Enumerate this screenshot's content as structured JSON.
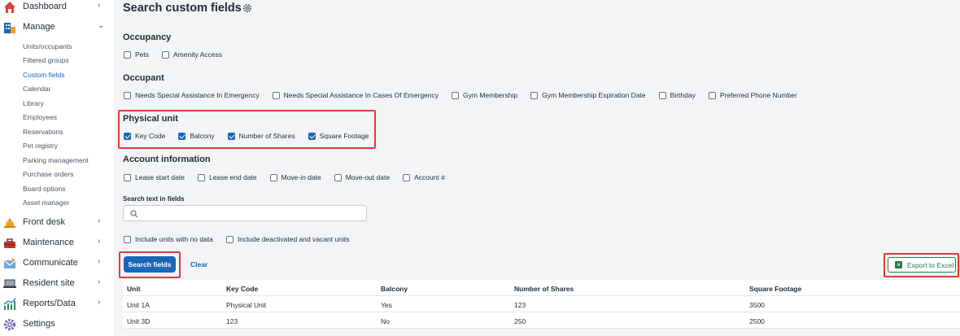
{
  "sidebar": {
    "top_items": [
      {
        "label": "Dashboard",
        "icon": "home-icon",
        "chevron": "›"
      },
      {
        "label": "Manage",
        "icon": "building-icon",
        "chevron": "⌄"
      }
    ],
    "manage_sub": [
      "Units/occupants",
      "Filtered groups",
      "Custom fields",
      "Calendar",
      "Library",
      "Employees",
      "Reservations",
      "Pet registry",
      "Parking management",
      "Purchase orders",
      "Board options",
      "Asset manager"
    ],
    "bottom_items": [
      {
        "label": "Front desk",
        "icon": "bell-icon",
        "chevron": "›"
      },
      {
        "label": "Maintenance",
        "icon": "toolbox-icon",
        "chevron": "›"
      },
      {
        "label": "Communicate",
        "icon": "mail-icon",
        "chevron": "›"
      },
      {
        "label": "Resident site",
        "icon": "laptop-icon",
        "chevron": "›"
      },
      {
        "label": "Reports/Data",
        "icon": "chart-icon",
        "chevron": "›"
      },
      {
        "label": "Settings",
        "icon": "gear-icon"
      }
    ]
  },
  "page": {
    "title": "Search custom fields"
  },
  "sections": {
    "occupancy": {
      "title": "Occupancy",
      "fields": [
        "Pets",
        "Amenity Access"
      ]
    },
    "occupant": {
      "title": "Occupant",
      "fields": [
        "Needs Special Assistance In Emergency",
        "Needs Special Assistance In Cases Of Emergency",
        "Gym Membership",
        "Gym Membership Expiration Date",
        "Birthday",
        "Preferred Phone Number"
      ]
    },
    "physical_unit": {
      "title": "Physical unit",
      "fields": [
        "Key Code",
        "Balcony",
        "Number of Shares",
        "Square Footage"
      ]
    },
    "account": {
      "title": "Account information",
      "fields": [
        "Lease start date",
        "Lease end date",
        "Move-in date",
        "Move-out date",
        "Account #"
      ]
    }
  },
  "search": {
    "label": "Search text in fields",
    "value": "",
    "placeholder": ""
  },
  "options": [
    "Include units with no data",
    "Include deactivated and vacant units"
  ],
  "actions": {
    "search": "Search fields",
    "clear": "Clear",
    "export": "Export to Excel"
  },
  "table": {
    "headers": [
      "Unit",
      "Key Code",
      "Balcony",
      "Number of Shares",
      "Square Footage"
    ],
    "rows": [
      [
        "Unit 1A",
        "Physical Unit",
        "Yes",
        "123",
        "3500"
      ],
      [
        "Unit 3D",
        "123",
        "No",
        "250",
        "2500"
      ]
    ]
  },
  "colors": {
    "accent": "#1a66b8",
    "highlight": "#e03a3a",
    "excel": "#1e7e4a"
  }
}
